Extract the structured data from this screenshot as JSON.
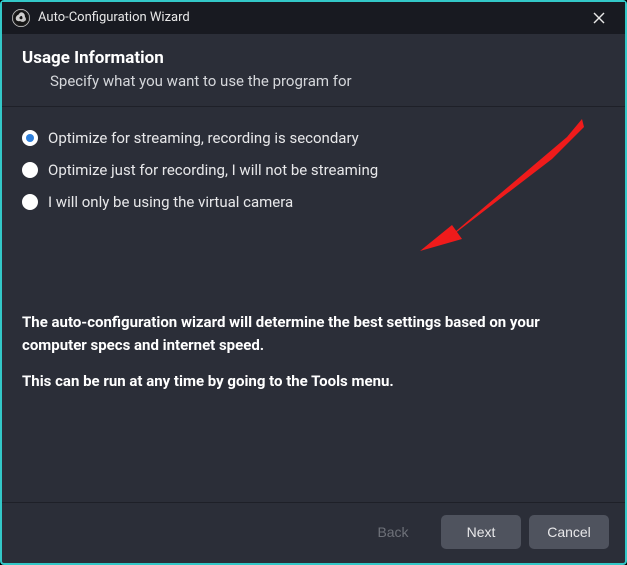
{
  "titlebar": {
    "title": "Auto-Configuration Wizard"
  },
  "header": {
    "heading": "Usage Information",
    "subheading": "Specify what you want to use the program for"
  },
  "options": {
    "opt1": "Optimize for streaming, recording is secondary",
    "opt2": "Optimize just for recording, I will not be streaming",
    "opt3": "I will only be using the virtual camera"
  },
  "info": {
    "line1": "The auto-configuration wizard will determine the best settings based on your computer specs and internet speed.",
    "line2": "This can be run at any time by going to the Tools menu."
  },
  "buttons": {
    "back": "Back",
    "next": "Next",
    "cancel": "Cancel"
  }
}
